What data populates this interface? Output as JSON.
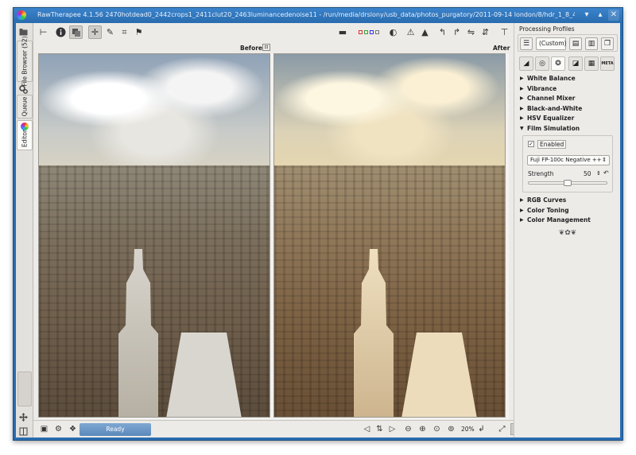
{
  "window": {
    "title": "RawTherapee 4.1.56 2470hotdead0_2442crops1_2411clut20_2463luminancedenoise11 - /run/media/drslony/usb_data/photos_purgatory/2011-09-14 london/8/hdr_1_8_49.dng",
    "buttons": [
      "close-window",
      "maximize",
      "close"
    ]
  },
  "vertical_tabs": {
    "file_browser": "File Browser (52)",
    "queue": "Queue",
    "editor": "Editor"
  },
  "viewer": {
    "before_label": "Before",
    "after_label": "After"
  },
  "status": {
    "ready_label": "Ready",
    "zoom_label": "20%"
  },
  "right_panel": {
    "processing_profiles_label": "Processing Profiles",
    "profile_select_value": "(Custom)",
    "tools": [
      "White Balance",
      "Vibrance",
      "Channel Mixer",
      "Black-and-White",
      "HSV Equalizer",
      "Film Simulation"
    ],
    "film_simulation": {
      "enabled_label": "Enabled",
      "enabled": true,
      "film_value": "Fuji FP-100c Negative ++",
      "strength_label": "Strength",
      "strength_value": "50",
      "strength_fraction": 0.5
    },
    "tools_after": [
      "RGB Curves",
      "Color Toning",
      "Color Management"
    ],
    "meta_tab_label": "META",
    "ornament": "❦✿❦"
  },
  "colors": {
    "titlebar": "#2a6db0",
    "ready_bar": "#5a88bb",
    "panel_bg": "#edebe8"
  }
}
